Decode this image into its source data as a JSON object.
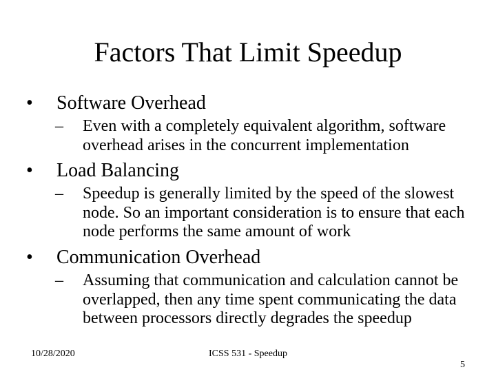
{
  "title": "Factors That Limit Speedup",
  "bullets": [
    {
      "heading": "Software Overhead",
      "sub": "Even with a completely equivalent algorithm, software overhead arises in the concurrent implementation"
    },
    {
      "heading": "Load Balancing",
      "sub": "Speedup is generally limited by the speed of the slowest node. So an important consideration is to ensure that each node performs the same amount of work"
    },
    {
      "heading": "Communication Overhead",
      "sub": "Assuming that communication and calculation cannot be overlapped, then any time spent communicating the data between processors directly degrades the speedup"
    }
  ],
  "footer": {
    "date": "10/28/2020",
    "course": "ICSS 531 - Speedup",
    "page": "5"
  }
}
